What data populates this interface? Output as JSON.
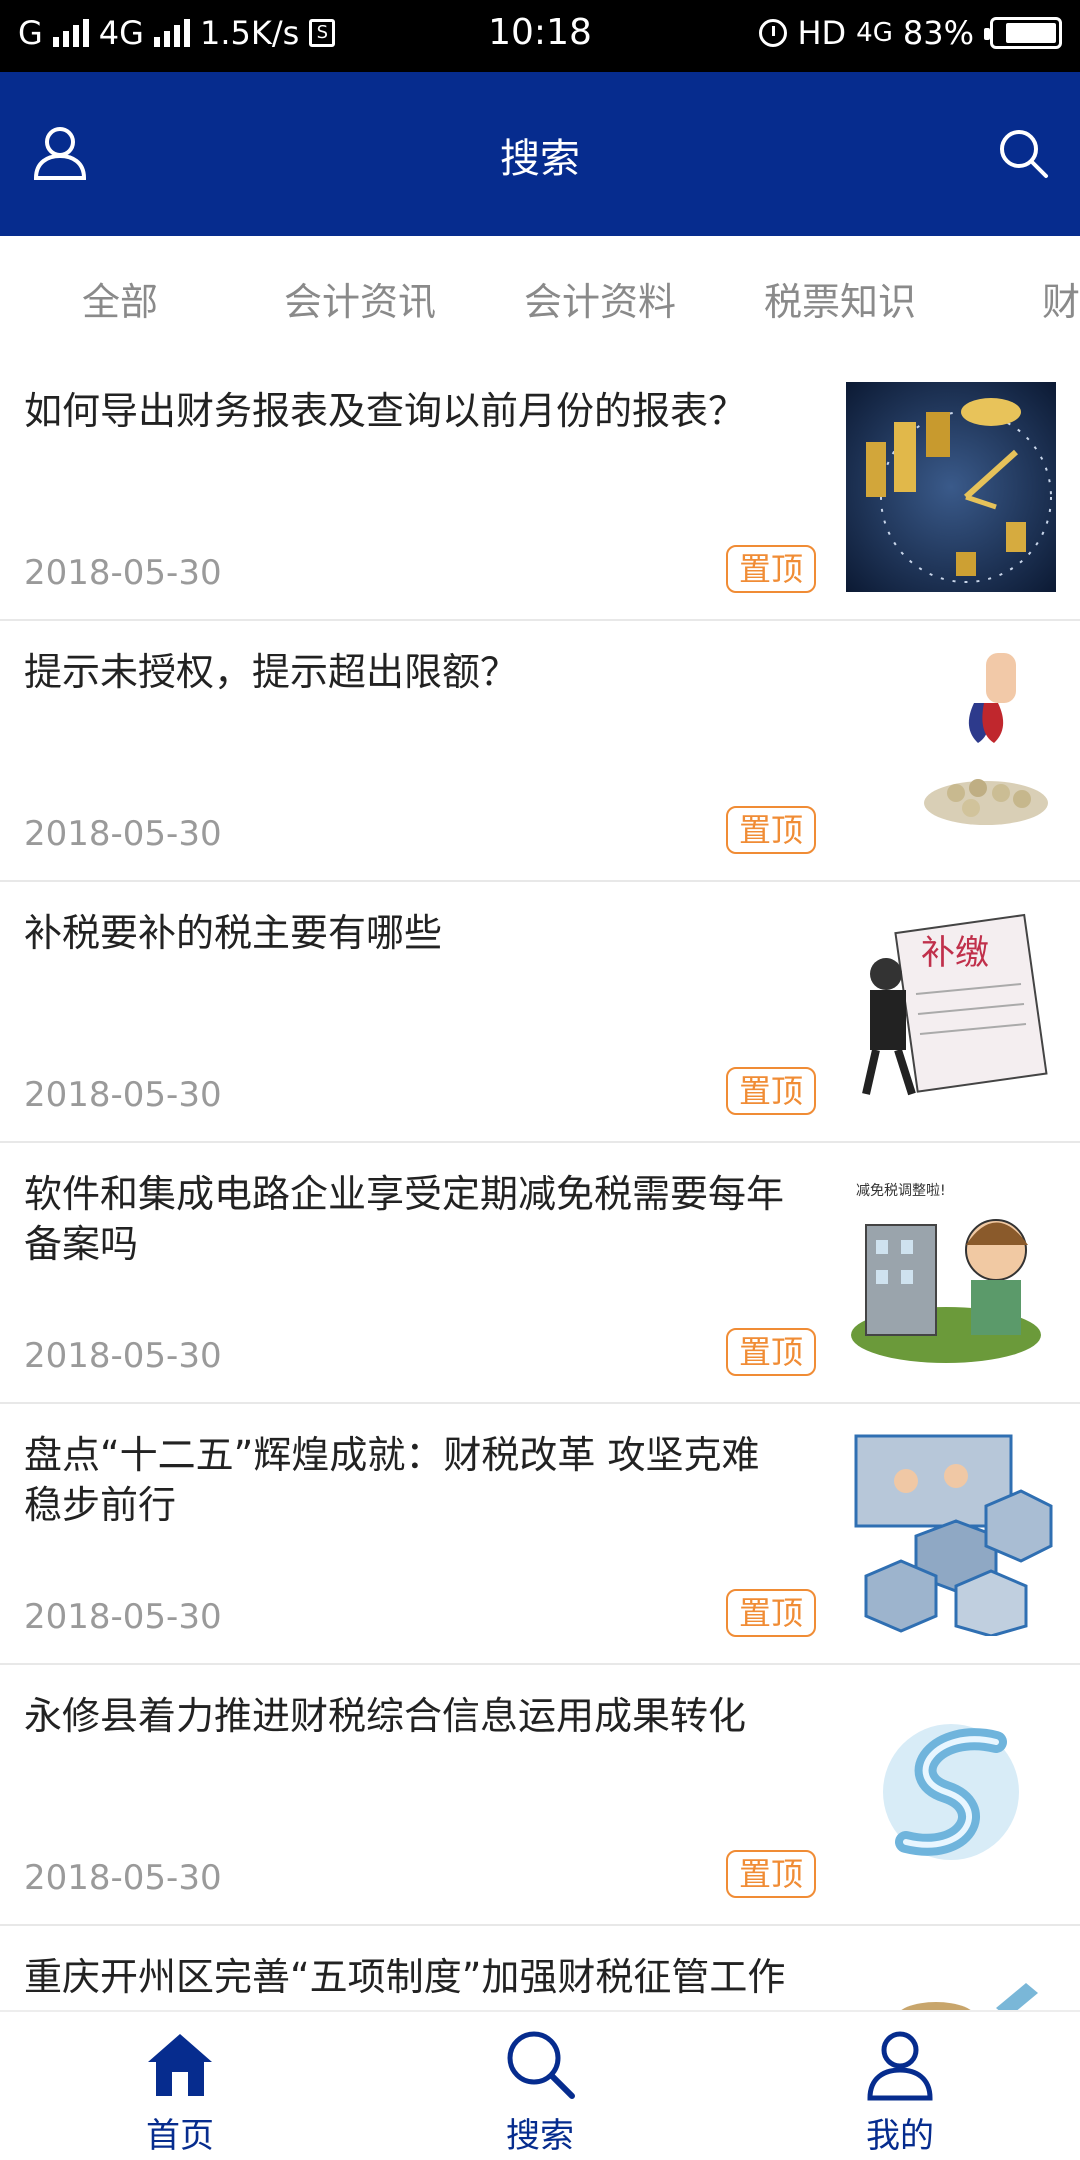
{
  "status_bar": {
    "carrier": "G",
    "network": "4G",
    "speed": "1.5K/s",
    "sim_icon_letter": "S",
    "time": "10:18",
    "hd": "HD",
    "network2": "4G",
    "battery_percent": "83%",
    "battery_level": 0.83
  },
  "header": {
    "title": "搜索",
    "user_icon": "user-icon",
    "search_icon": "search-icon",
    "color": "#062c8e"
  },
  "tabs": [
    "全部",
    "会计资讯",
    "会计资料",
    "税票知识",
    "财务"
  ],
  "list": {
    "pin_label": "置顶",
    "items": [
      {
        "title": "如何导出财务报表及查询以前月份的报表？",
        "date": "2018-05-30",
        "thumb": "clock-gold-coins-image"
      },
      {
        "title": "提示未授权，提示超出限额？",
        "date": "2018-05-30",
        "thumb": "magnet-coins-image"
      },
      {
        "title": "补税要补的税主要有哪些",
        "date": "2018-05-30",
        "thumb": "tax-cartoon-image"
      },
      {
        "title": "软件和集成电路企业享受定期减免税需要每年备案吗",
        "date": "2018-05-30",
        "thumb": "building-cartoon-image"
      },
      {
        "title": "盘点“十二五”辉煌成就：财税改革 攻坚克难稳步前行",
        "date": "2018-05-30",
        "thumb": "office-photo-collage-image"
      },
      {
        "title": "永修县着力推进财税综合信息运用成果转化",
        "date": "2018-05-30",
        "thumb": "water-swirl-image"
      },
      {
        "title": "重庆开州区完善“五项制度”加强财税征管工作",
        "date": "",
        "thumb": "partial-image"
      }
    ]
  },
  "bottom_nav": [
    {
      "label": "首页",
      "icon": "home-icon"
    },
    {
      "label": "搜索",
      "icon": "search-icon"
    },
    {
      "label": "我的",
      "icon": "profile-icon"
    }
  ],
  "colors": {
    "primary": "#062c8e",
    "pin": "#f08c35",
    "text": "#222222",
    "muted": "#9a9a9a"
  }
}
